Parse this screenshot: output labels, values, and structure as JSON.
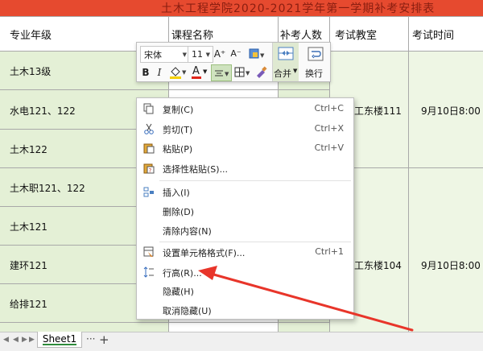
{
  "sheet": {
    "title": "土木工程学院2020-2021学年第一学期补考安排表",
    "headers": [
      "专业年级",
      "课程名称",
      "补考人数",
      "考试教室",
      "考试时间"
    ],
    "rows": [
      "土木13级",
      "水电121、122",
      "土木122",
      "土木职121、122",
      "土木121",
      "建环121",
      "给排121"
    ],
    "room1": "工东楼111",
    "time1": "9月10日8:00",
    "room2": "工东楼104",
    "time2": "9月10日8:00"
  },
  "mini_toolbar": {
    "font_name": "宋体",
    "font_size": "11",
    "grow_font": "A⁺",
    "shrink_font": "A⁻",
    "bold": "B",
    "italic": "I",
    "font_color_letter": "A",
    "merge_label": "合并",
    "wrap_label": "换行"
  },
  "context_menu": {
    "items": [
      {
        "label": "复制(C)",
        "shortcut": "Ctrl+C",
        "icon": "copy-icon"
      },
      {
        "label": "剪切(T)",
        "shortcut": "Ctrl+X",
        "icon": "cut-icon"
      },
      {
        "label": "粘贴(P)",
        "shortcut": "Ctrl+V",
        "icon": "paste-icon"
      },
      {
        "label": "选择性粘贴(S)...",
        "shortcut": "",
        "icon": "paste-special-icon"
      },
      {
        "label": "插入(I)",
        "shortcut": "",
        "icon": "insert-icon"
      },
      {
        "label": "删除(D)",
        "shortcut": "",
        "icon": ""
      },
      {
        "label": "清除内容(N)",
        "shortcut": "",
        "icon": ""
      },
      {
        "label": "设置单元格格式(F)...",
        "shortcut": "Ctrl+1",
        "icon": "format-cells-icon"
      },
      {
        "label": "行高(R)...",
        "shortcut": "",
        "icon": "row-height-icon"
      },
      {
        "label": "隐藏(H)",
        "shortcut": "",
        "icon": ""
      },
      {
        "label": "取消隐藏(U)",
        "shortcut": "",
        "icon": ""
      }
    ]
  },
  "tabs": {
    "sheet1": "Sheet1",
    "more": "···",
    "add": "+"
  },
  "colors": {
    "title_band": "#e64a2f",
    "green_fill": "#e4f0d6",
    "arrow": "#e8352a",
    "tab_accent": "#2e8b3b"
  }
}
